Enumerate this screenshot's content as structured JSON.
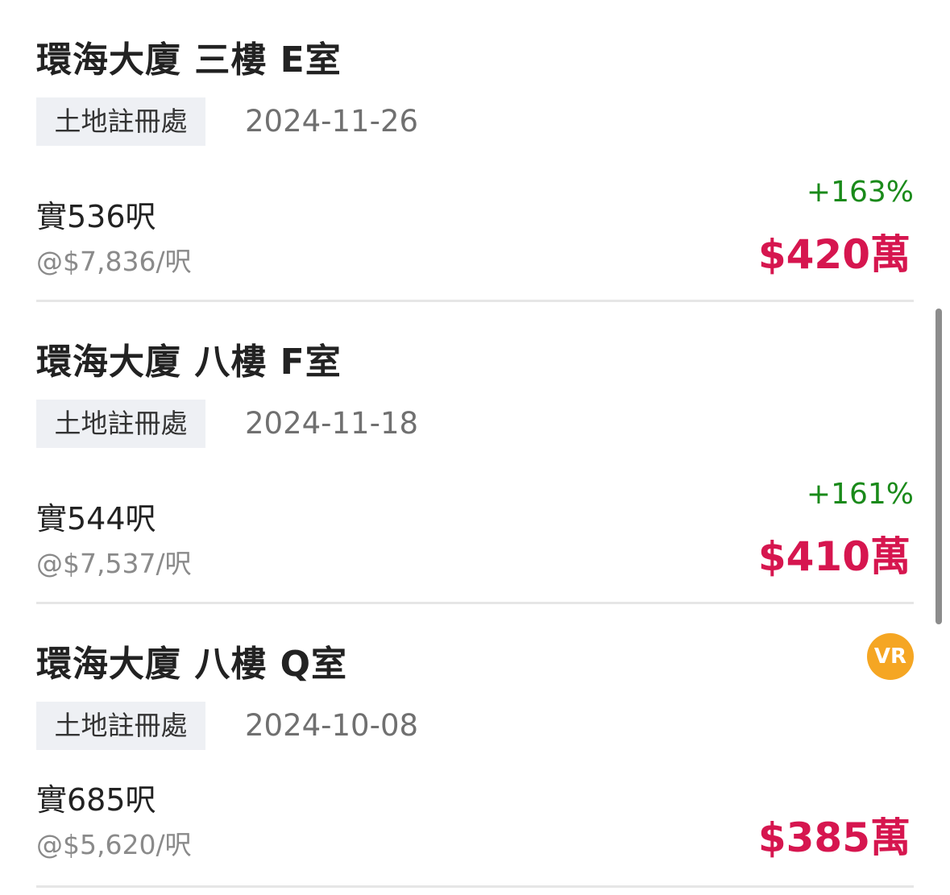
{
  "listings": [
    {
      "title": "環海大廈 三樓 E室",
      "source": "土地註冊處",
      "date": "2024-11-26",
      "area": "實536呎",
      "unit_price": "@$7,836/呎",
      "change": "+163%",
      "price": "$420萬",
      "has_vr": false
    },
    {
      "title": "環海大廈 八樓 F室",
      "source": "土地註冊處",
      "date": "2024-11-18",
      "area": "實544呎",
      "unit_price": "@$7,537/呎",
      "change": "+161%",
      "price": "$410萬",
      "has_vr": false
    },
    {
      "title": "環海大廈 八樓 Q室",
      "source": "土地註冊處",
      "date": "2024-10-08",
      "area": "實685呎",
      "unit_price": "@$5,620/呎",
      "change": "",
      "price": "$385萬",
      "has_vr": true,
      "vr_label": "VR"
    }
  ],
  "colors": {
    "price": "#d6164f",
    "change_up": "#1a8a1a",
    "tag_bg": "#eef0f4",
    "vr_badge": "#f5a623"
  }
}
